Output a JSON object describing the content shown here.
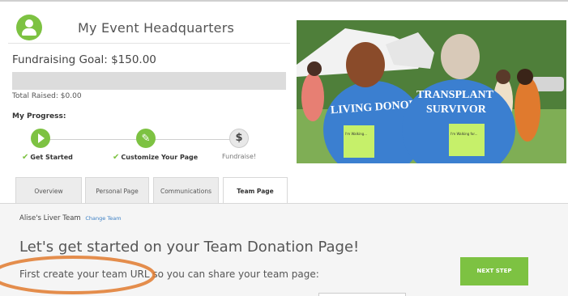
{
  "header": {
    "title": "My Event Headquarters",
    "avatar_icon": "user-icon"
  },
  "fundraising": {
    "goal_label": "Fundraising Goal: $150.00",
    "raised_label": "Total Raised: $0.00",
    "progress_fraction": 0
  },
  "progress": {
    "label": "My Progress:",
    "steps": [
      {
        "label": "Get Started",
        "done": true,
        "icon": "play-icon"
      },
      {
        "label": "Customize Your Page",
        "done": true,
        "icon": "pencil-icon"
      },
      {
        "label": "Fundraise!",
        "done": false,
        "icon": "dollar-icon",
        "glyph": "$"
      }
    ]
  },
  "photo": {
    "shirt_left": "LIVING DONOR",
    "shirt_right_line1": "TRANSPLANT",
    "shirt_right_line2": "SURVIVOR",
    "tag_left": "I'm Walking...",
    "tag_right": "I'm Walking for..."
  },
  "tabs": [
    {
      "label": "Overview",
      "active": false
    },
    {
      "label": "Personal Page",
      "active": false
    },
    {
      "label": "Communications",
      "active": false
    },
    {
      "label": "Team Page",
      "active": true
    }
  ],
  "team": {
    "name": "Alise's Liver Team",
    "change_label": "Change Team"
  },
  "main": {
    "heading": "Let's get started on your Team Donation Page!",
    "subheading": "First create your team URL so you can share your team page:",
    "next_button": "NEXT STEP"
  },
  "colors": {
    "accent": "#7dc242",
    "link": "#3b7fc4",
    "highlight": "#e07a2e"
  }
}
